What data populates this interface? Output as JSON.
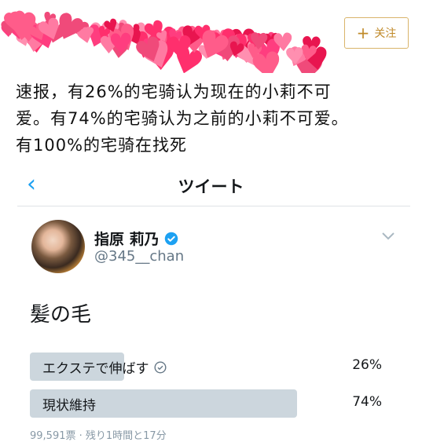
{
  "follow_button": {
    "label": "关注",
    "icon": "plus-icon"
  },
  "caption": {
    "line1": "速报，有26%的宅骑认为现在的小莉不可",
    "line2": "爱。有74%的宅骑认为之前的小莉不可爱。",
    "line3": "有100%的宅骑在找死"
  },
  "header": {
    "title": "ツイート",
    "back_icon": "chevron-left-icon"
  },
  "user": {
    "display_name": "指原 莉乃",
    "handle": "@345__chan",
    "verified_icon": "verified-badge-icon"
  },
  "tweet": {
    "text": "髪の毛"
  },
  "poll": {
    "options": [
      {
        "label": "エクステで伸ばす",
        "percent_label": "26%",
        "percent": 26,
        "selected": true
      },
      {
        "label": "現状維持",
        "percent_label": "74%",
        "percent": 74,
        "selected": false
      }
    ],
    "meta": "99,591票 · 残り1時間と17分"
  },
  "colors": {
    "accent": "#1da1f2",
    "poll_bar": "#ccd6dd",
    "follow": "#c08a2a"
  }
}
